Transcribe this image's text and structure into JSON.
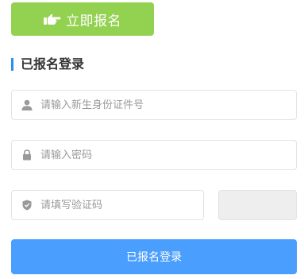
{
  "register_button": {
    "label": "立即报名",
    "icon": "pointing-hand-icon"
  },
  "section": {
    "title": "已报名登录",
    "accent_color": "#2e8fea"
  },
  "form": {
    "id_field": {
      "placeholder": "请输入新生身份证件号",
      "icon": "user-icon"
    },
    "password_field": {
      "placeholder": "请输入密码",
      "icon": "lock-icon"
    },
    "captcha_field": {
      "placeholder": "请填写验证码",
      "icon": "shield-icon"
    }
  },
  "login_button": {
    "label": "已报名登录"
  },
  "colors": {
    "register_button": "#93d150",
    "login_button": "#4a9efd",
    "captcha_box": "#eeeeee",
    "field_border": "#e3e3e3"
  }
}
